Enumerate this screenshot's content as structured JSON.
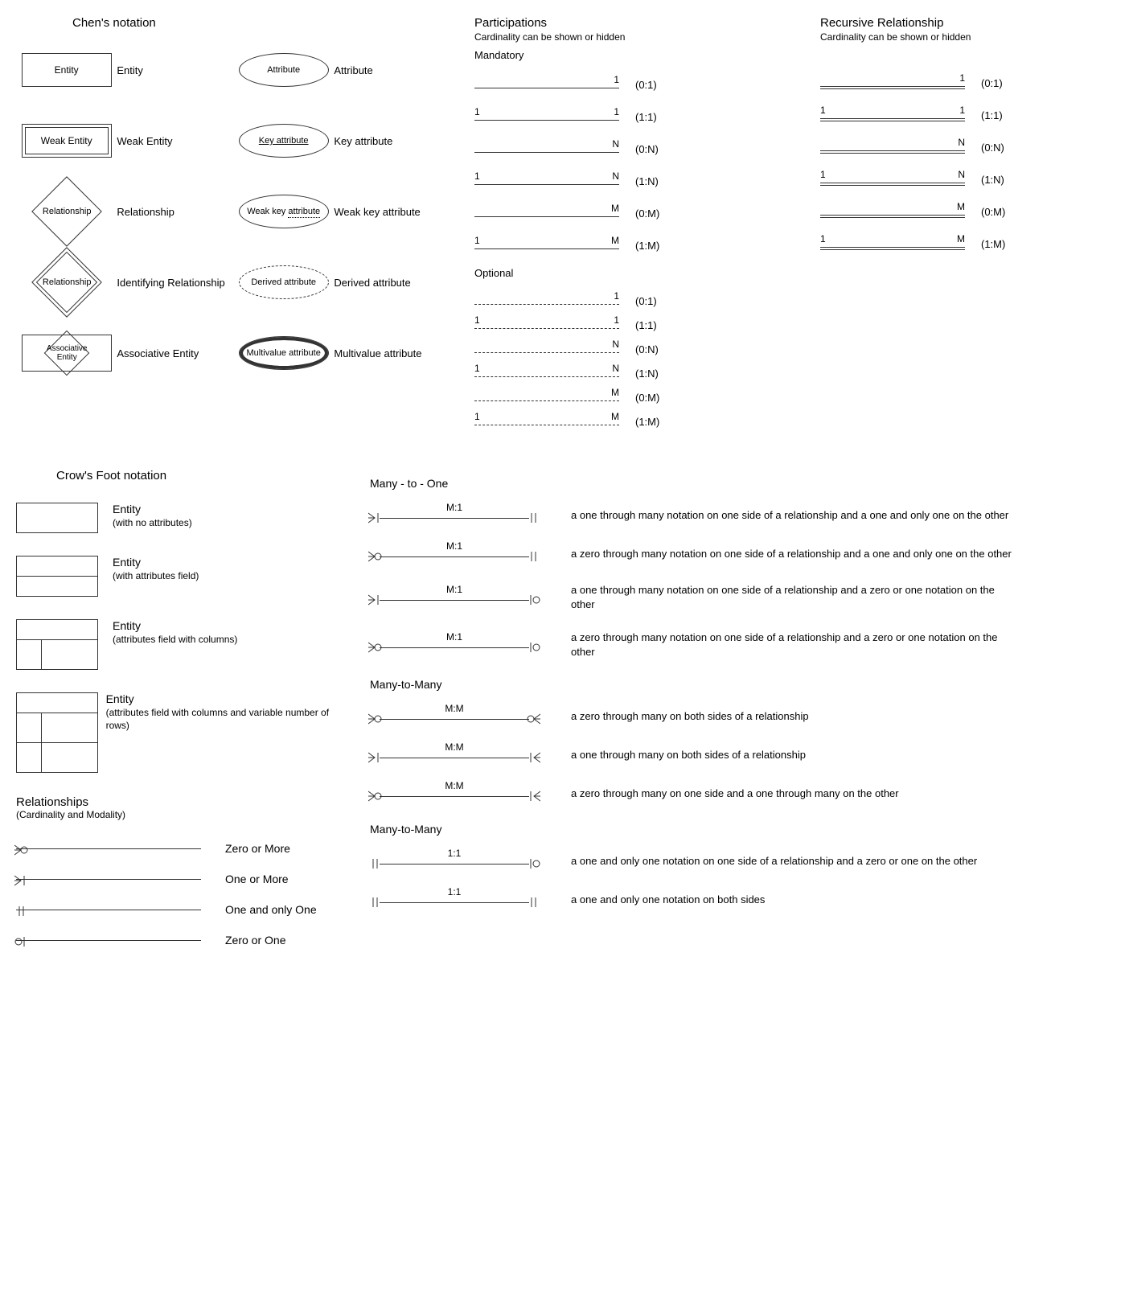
{
  "chen": {
    "title": "Chen's notation",
    "left": [
      {
        "shape": "entity",
        "text": "Entity",
        "label": "Entity"
      },
      {
        "shape": "weak",
        "text": "Weak Entity",
        "label": "Weak Entity"
      },
      {
        "shape": "diamond",
        "text": "Relationship",
        "label": "Relationship"
      },
      {
        "shape": "diamond-dbl",
        "text": "Relationship",
        "label": "Identifying Relationship"
      },
      {
        "shape": "assoc",
        "text": "Associative Entity",
        "label": "Associative Entity"
      }
    ],
    "right": [
      {
        "shape": "ellipse",
        "text": "Attribute",
        "label": "Attribute"
      },
      {
        "shape": "ellipse-key",
        "text": "Key attribute",
        "label": "Key attribute"
      },
      {
        "shape": "ellipse-wkey",
        "text": "Weak key attribute",
        "label": "Weak key attribute"
      },
      {
        "shape": "ellipse-dash",
        "text": "Derived attribute",
        "label": "Derived attribute"
      },
      {
        "shape": "ellipse-dbl",
        "text": "Multivalue attribute",
        "label": "Multivalue attribute"
      }
    ]
  },
  "participations": {
    "title": "Participations",
    "sub": "Cardinality can be shown or hidden",
    "mandatory_h": "Mandatory",
    "optional_h": "Optional",
    "mandatory": [
      {
        "left": "",
        "right": "1",
        "card": "(0:1)"
      },
      {
        "left": "1",
        "right": "1",
        "card": "(1:1)"
      },
      {
        "left": "",
        "right": "N",
        "card": "(0:N)"
      },
      {
        "left": "1",
        "right": "N",
        "card": "(1:N)"
      },
      {
        "left": "",
        "right": "M",
        "card": "(0:M)"
      },
      {
        "left": "1",
        "right": "M",
        "card": "(1:M)"
      }
    ],
    "optional": [
      {
        "left": "",
        "right": "1",
        "card": "(0:1)"
      },
      {
        "left": "1",
        "right": "1",
        "card": "(1:1)"
      },
      {
        "left": "",
        "right": "N",
        "card": "(0:N)"
      },
      {
        "left": "1",
        "right": "N",
        "card": "(1:N)"
      },
      {
        "left": "",
        "right": "M",
        "card": "(0:M)"
      },
      {
        "left": "1",
        "right": "M",
        "card": "(1:M)"
      }
    ]
  },
  "recursive": {
    "title": "Recursive Relationship",
    "sub": "Cardinality can be shown or hidden",
    "rows": [
      {
        "left": "",
        "right": "1",
        "card": "(0:1)"
      },
      {
        "left": "1",
        "right": "1",
        "card": "(1:1)"
      },
      {
        "left": "",
        "right": "N",
        "card": "(0:N)"
      },
      {
        "left": "1",
        "right": "N",
        "card": "(1:N)"
      },
      {
        "left": "",
        "right": "M",
        "card": "(0:M)"
      },
      {
        "left": "1",
        "right": "M",
        "card": "(1:M)"
      }
    ]
  },
  "crows": {
    "title": "Crow's Foot notation",
    "entities": [
      {
        "type": "e1",
        "label": "Entity",
        "sub": "(with no attributes)"
      },
      {
        "type": "e2",
        "label": "Entity",
        "sub": "(with attributes field)"
      },
      {
        "type": "e3",
        "label": "Entity",
        "sub": "(attributes field with columns)"
      },
      {
        "type": "e4",
        "label": "Entity",
        "sub": "(attributes field with columns and variable number of rows)"
      }
    ],
    "rel_h": "Relationships",
    "rel_sub": "(Cardinality and Modality)",
    "rels": [
      {
        "end": "zero-many",
        "label": "Zero or More"
      },
      {
        "end": "one-many",
        "label": "One or More"
      },
      {
        "end": "one-one",
        "label": "One and only One"
      },
      {
        "end": "zero-one",
        "label": "Zero or One"
      }
    ]
  },
  "mto": {
    "h1": "Many - to - One",
    "rows1": [
      {
        "left": "one-many",
        "right": "one-one",
        "lbl": "M:1",
        "desc": "a one through many notation on one side of a relationship and a one and only one on the other"
      },
      {
        "left": "zero-many",
        "right": "one-one",
        "lbl": "M:1",
        "desc": "a zero through many notation on one side of a relationship and a one and only one on the other"
      },
      {
        "left": "one-many",
        "right": "zero-one",
        "lbl": "M:1",
        "desc": "a one through many notation on one side of a relationship and a zero or one notation on the other"
      },
      {
        "left": "zero-many",
        "right": "zero-one",
        "lbl": "M:1",
        "desc": "a zero through many notation on one side of a relationship and a zero or one notation on the other"
      }
    ],
    "h2": "Many-to-Many",
    "rows2": [
      {
        "left": "zero-many",
        "right": "zero-many",
        "lbl": "M:M",
        "desc": "a zero through many on both sides of a relationship"
      },
      {
        "left": "one-many",
        "right": "one-many",
        "lbl": "M:M",
        "desc": "a one through many on both sides of a relationship"
      },
      {
        "left": "zero-many",
        "right": "one-many",
        "lbl": "M:M",
        "desc": "a zero through many on one side and a one through many on the other"
      }
    ],
    "h3": "Many-to-Many",
    "rows3": [
      {
        "left": "one-one",
        "right": "zero-one",
        "lbl": "1:1",
        "desc": "a one and only one notation on one side of a relationship and a zero or one on the other"
      },
      {
        "left": "one-one",
        "right": "one-one",
        "lbl": "1:1",
        "desc": "a one and only one notation on both sides"
      }
    ]
  }
}
